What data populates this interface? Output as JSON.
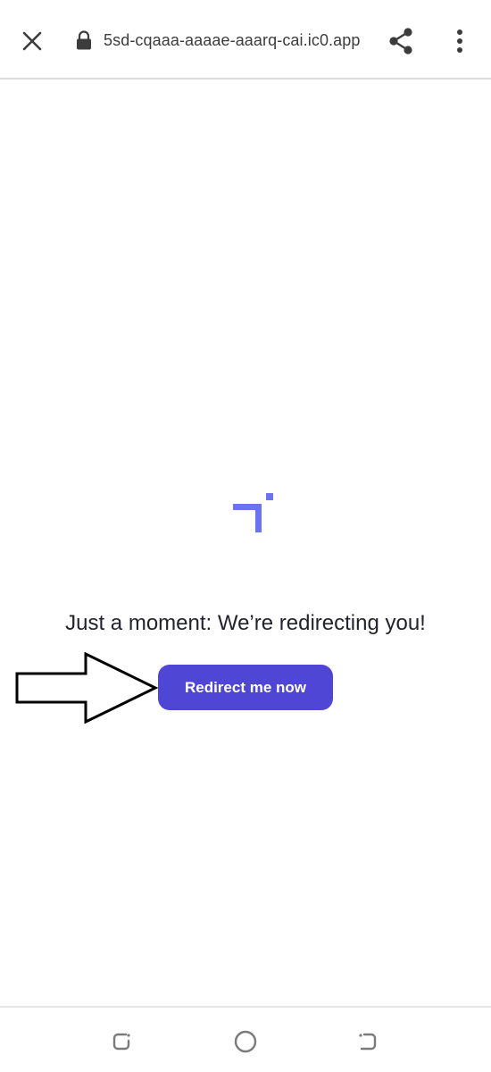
{
  "browser": {
    "url": "5sd-cqaaa-aaaae-aaarq-cai.ic0.app",
    "icons": {
      "close": "close-icon",
      "lock": "lock-icon",
      "share": "share-icon",
      "menu": "more-vert-icon"
    }
  },
  "main": {
    "logo_icon": "app-logo-icon",
    "message": "Just a moment: We’re redirecting you!",
    "redirect_button_label": "Redirect me now",
    "annotation_icon": "arrow-right-icon"
  },
  "navbar": {
    "icons": [
      "recents-icon",
      "home-icon",
      "back-icon"
    ]
  },
  "colors": {
    "accent": "#4f46d6",
    "logo": "#6a73f0",
    "text": "#222230",
    "toolbar_icon": "#3c3c3c",
    "nav_icon": "#7a7a7a"
  }
}
